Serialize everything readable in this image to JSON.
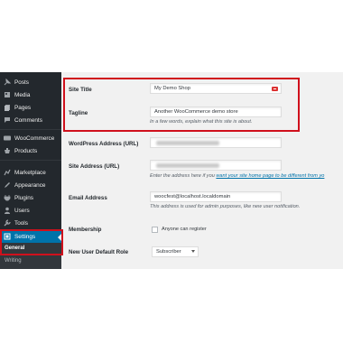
{
  "sidebar": {
    "items": [
      {
        "label": "Posts",
        "icon": "pin-icon"
      },
      {
        "label": "Media",
        "icon": "media-icon"
      },
      {
        "label": "Pages",
        "icon": "pages-icon"
      },
      {
        "label": "Comments",
        "icon": "comments-icon"
      },
      {
        "label": "WooCommerce",
        "icon": "woocommerce-icon"
      },
      {
        "label": "Products",
        "icon": "products-icon"
      },
      {
        "label": "Marketplace",
        "icon": "marketplace-icon"
      },
      {
        "label": "Appearance",
        "icon": "appearance-icon"
      },
      {
        "label": "Plugins",
        "icon": "plugins-icon"
      },
      {
        "label": "Users",
        "icon": "users-icon"
      },
      {
        "label": "Tools",
        "icon": "tools-icon"
      },
      {
        "label": "Settings",
        "icon": "settings-icon"
      }
    ],
    "submenu": {
      "general": "General",
      "writing": "Writing"
    }
  },
  "form": {
    "site_title": {
      "label": "Site Title",
      "value": "My Demo Shop"
    },
    "tagline": {
      "label": "Tagline",
      "value": "Another WooCommerce demo store",
      "description": "In a few words, explain what this site is about."
    },
    "wp_address": {
      "label": "WordPress Address (URL)"
    },
    "site_address": {
      "label": "Site Address (URL)",
      "description_pre": "Enter the address here if you ",
      "description_link": "want your site home page to be different from yo"
    },
    "email": {
      "label": "Email Address",
      "value": "woocfest@localhost.localdomain",
      "description": "This address is used for admin purposes, like new user notification."
    },
    "membership": {
      "label": "Membership",
      "checkbox_label": "Anyone can register"
    },
    "default_role": {
      "label": "New User Default Role",
      "value": "Subscriber"
    }
  },
  "colors": {
    "sidebar": "#23282d",
    "accent": "#0073aa",
    "highlight": "#d0101c"
  }
}
